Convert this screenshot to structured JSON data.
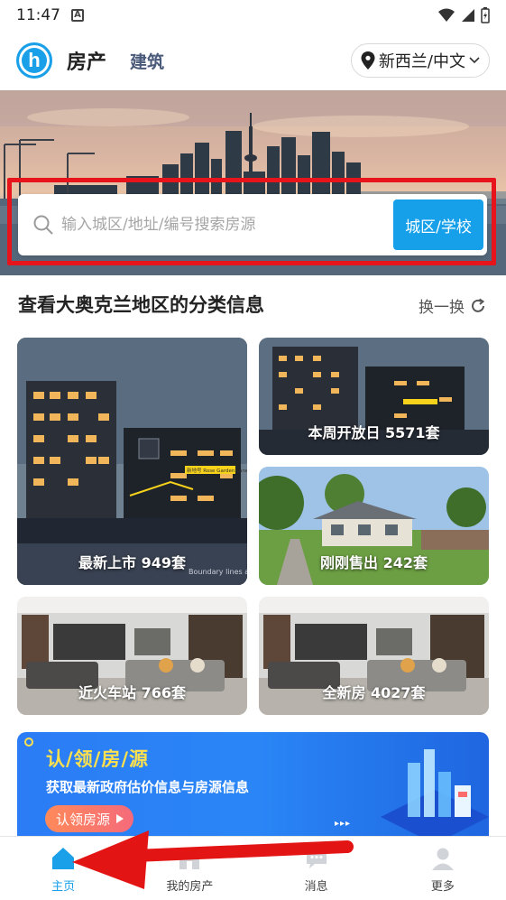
{
  "status_bar": {
    "time": "11:47",
    "notification_letter": "A"
  },
  "header": {
    "logo_letter": "h",
    "tab_active": "房产",
    "tab_other": "建筑",
    "region": "新西兰/中文"
  },
  "search": {
    "placeholder": "输入城区/地址/编号搜索房源",
    "button": "城区/学校"
  },
  "section": {
    "title": "查看大奥克兰地区的分类信息",
    "refresh": "换一换"
  },
  "cards": [
    {
      "label": "最新上市 949套"
    },
    {
      "label": "本周开放日 5571套"
    },
    {
      "label": "刚刚售出 242套"
    },
    {
      "label": "近火车站 766套"
    },
    {
      "label": "全新房 4027套"
    }
  ],
  "card_image_text": {
    "sign": "新地号 Rose Garden Lane",
    "boundary": "Boundary lines are"
  },
  "promo": {
    "headline": "认/领/房/源",
    "subline": "获取最新政府估价信息与房源信息",
    "cta": "认领房源",
    "dots": "▸▸▸"
  },
  "bottom_nav": [
    {
      "label": "主页",
      "icon": "home-icon",
      "active": true
    },
    {
      "label": "我的房产",
      "icon": "house-icon",
      "active": false
    },
    {
      "label": "消息",
      "icon": "message-icon",
      "active": false
    },
    {
      "label": "更多",
      "icon": "profile-icon",
      "active": false
    }
  ],
  "colors": {
    "accent": "#16a0ea",
    "highlight": "#e8141c",
    "promo_yellow": "#ffe14d"
  }
}
